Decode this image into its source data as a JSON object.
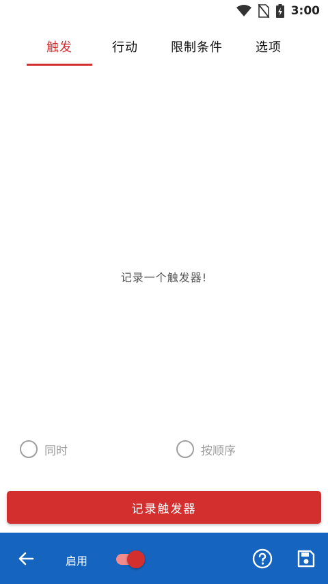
{
  "status_bar": {
    "time": "3:00",
    "icons": [
      "wifi-icon",
      "no-sim-icon",
      "battery-charging-icon"
    ]
  },
  "tabs": [
    {
      "label": "触发",
      "active": true
    },
    {
      "label": "行动",
      "active": false
    },
    {
      "label": "限制条件",
      "active": false
    },
    {
      "label": "选项",
      "active": false
    }
  ],
  "main": {
    "empty_message": "记录一个触发器!"
  },
  "trigger_mode": {
    "options": [
      {
        "label": "同时",
        "selected": false
      },
      {
        "label": "按顺序",
        "selected": false
      }
    ]
  },
  "record_button": {
    "label": "记录触发器"
  },
  "bottom_bar": {
    "enable_label": "启用",
    "enabled": true,
    "icons": [
      "back-arrow-icon",
      "help-icon",
      "save-icon"
    ]
  },
  "colors": {
    "accent": "#d32f2f",
    "bottom_bar": "#1565c0",
    "switch_track": "#f28b8b",
    "disabled_text": "#9e9e9e"
  }
}
